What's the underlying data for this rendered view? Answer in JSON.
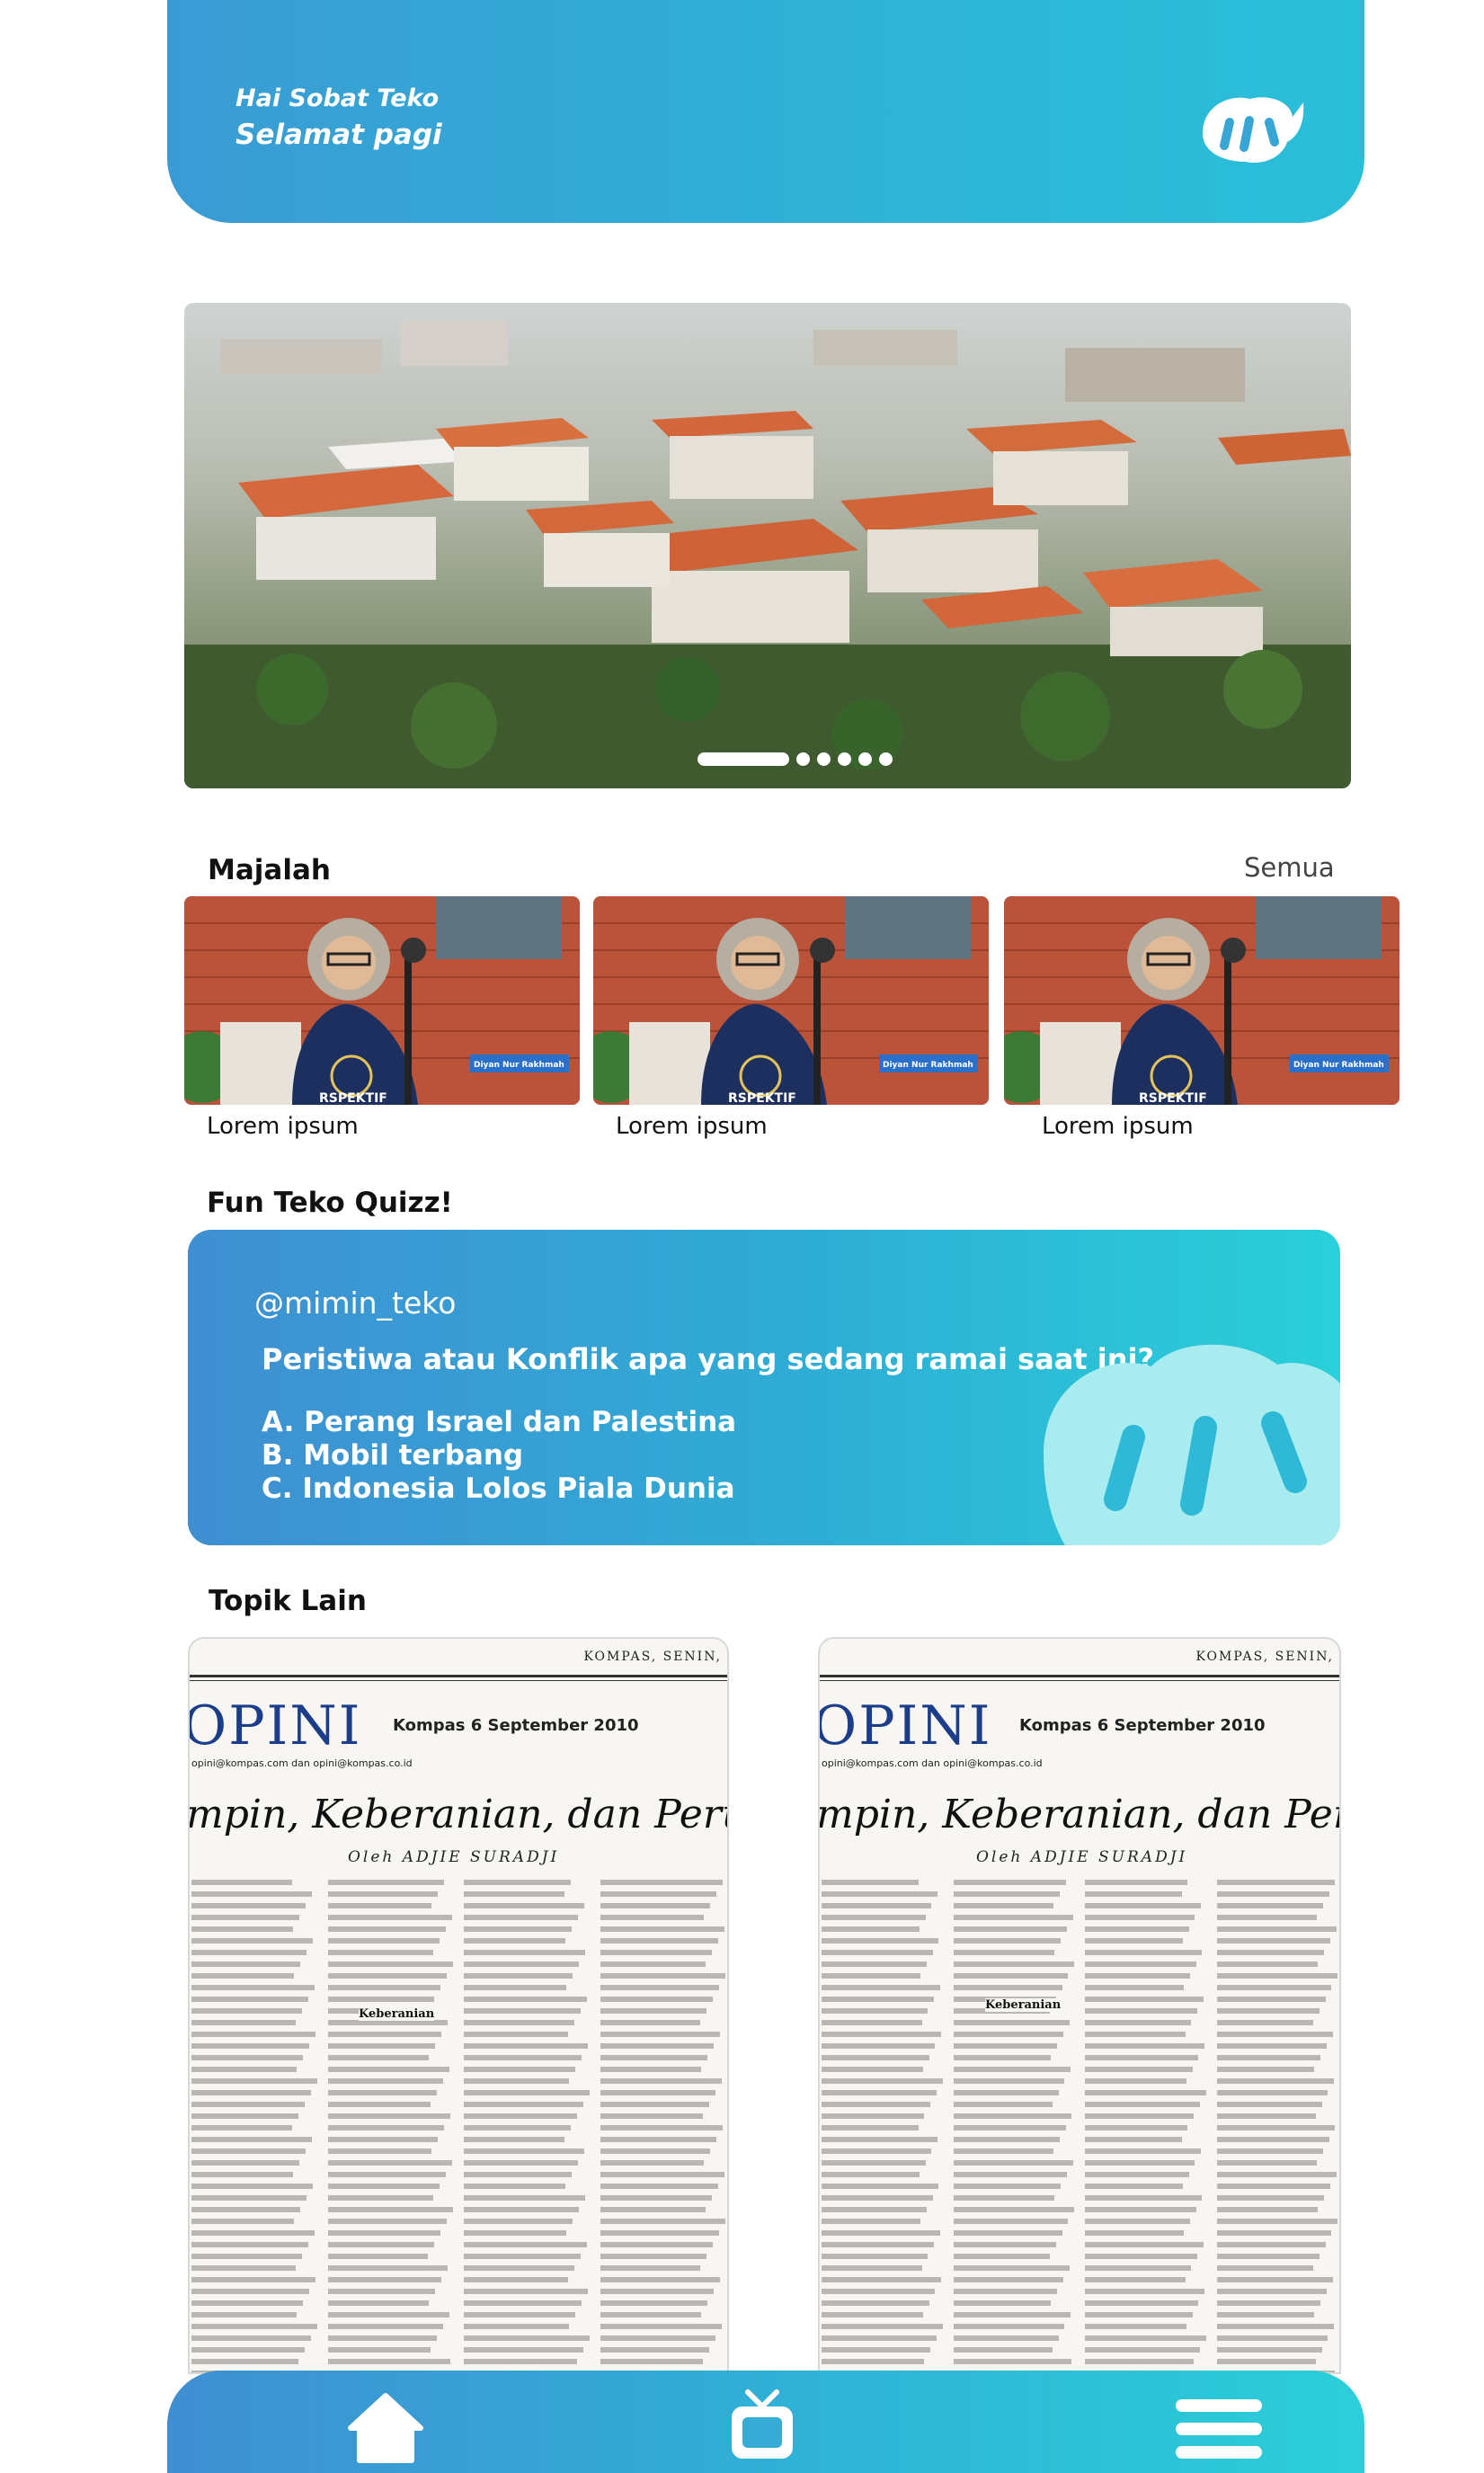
{
  "header": {
    "greeting": "Hai Sobat Teko",
    "time_greeting": "Selamat pagi",
    "logo_icon": "teko-logo-icon"
  },
  "banner": {
    "image": "campus-aerial-photo",
    "slide_count": 6,
    "active_slide": 1
  },
  "magazine": {
    "title": "Majalah",
    "see_all": "Semua",
    "items": [
      {
        "label": "Lorem ipsum"
      },
      {
        "label": "Lorem ipsum"
      },
      {
        "label": "Lorem ipsum"
      }
    ]
  },
  "quiz": {
    "title": "Fun Teko Quizz!",
    "user": "@mimin_teko",
    "question": "Peristiwa atau Konflik apa yang sedang ramai saat ini?",
    "options": [
      "A. Perang Israel dan Palestina",
      "B. Mobil terbang",
      "C. Indonesia Lolos Piala Dunia"
    ]
  },
  "topics": {
    "title": "Topik Lain",
    "papers": [
      {
        "masthead": "KOMPAS, SENIN,",
        "section": "OPINI",
        "date": "Kompas 6 September 2010",
        "email": "opini@kompas.com dan opini@kompas.co.id",
        "headline": "mpin, Keberanian, dan Perubah",
        "byline": "Oleh ADJIE SURADJI",
        "subhead": "Keberanian"
      },
      {
        "masthead": "KOMPAS, SENIN,",
        "section": "OPINI",
        "date": "Kompas 6 September 2010",
        "email": "opini@kompas.com dan opini@kompas.co.id",
        "headline": "mpin, Keberanian, dan Perubah",
        "byline": "Oleh ADJIE SURADJI",
        "subhead": "Keberanian"
      }
    ]
  },
  "nav": {
    "items": [
      {
        "icon": "home-icon"
      },
      {
        "icon": "tv-icon"
      },
      {
        "icon": "menu-icon"
      }
    ]
  },
  "colors": {
    "primary": "#3a9bd4",
    "accent": "#2ad0d9",
    "mascot": "#a9ecf0"
  }
}
